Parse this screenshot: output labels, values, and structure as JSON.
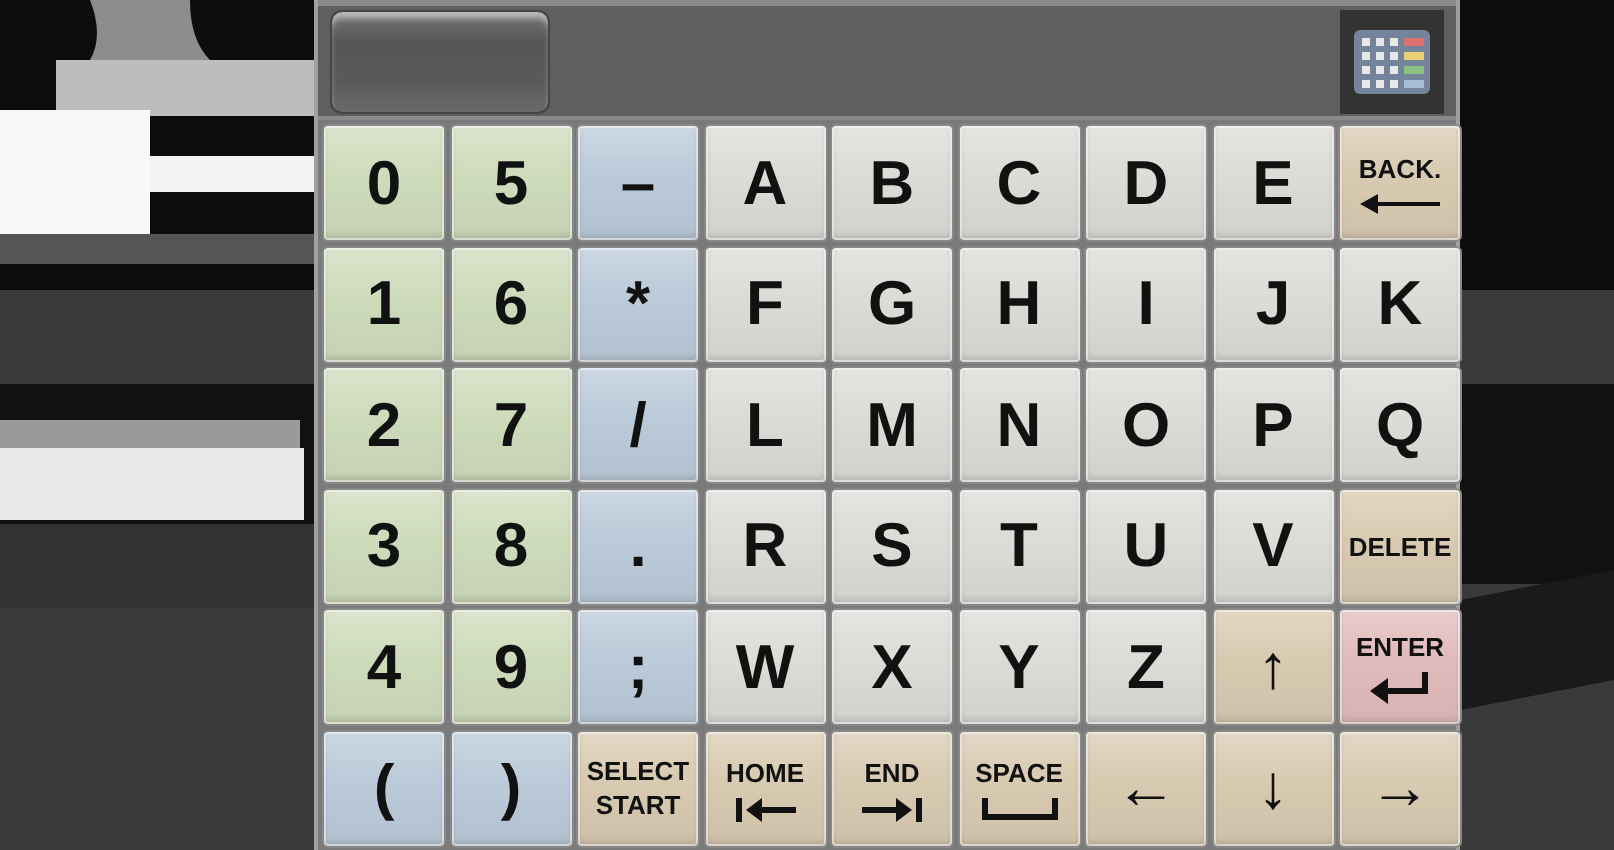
{
  "keyboard": {
    "rows": [
      [
        {
          "label": "0",
          "kind": "char",
          "color": "#cfdcbc"
        },
        {
          "label": "5",
          "kind": "char",
          "color": "#cfdcbc"
        },
        {
          "label": "–",
          "kind": "char",
          "color": "#bccbda"
        },
        {
          "label": "A",
          "kind": "char",
          "color": "#dddcd7"
        },
        {
          "label": "B",
          "kind": "char",
          "color": "#dddcd7"
        },
        {
          "label": "C",
          "kind": "char",
          "color": "#dddcd7"
        },
        {
          "label": "D",
          "kind": "char",
          "color": "#dddcd7"
        },
        {
          "label": "E",
          "kind": "char",
          "color": "#dddcd7"
        },
        {
          "label": "BACK.",
          "kind": "back",
          "color": "#d9cbb2"
        }
      ],
      [
        {
          "label": "1",
          "kind": "char",
          "color": "#cfdcbc"
        },
        {
          "label": "6",
          "kind": "char",
          "color": "#cfdcbc"
        },
        {
          "label": "*",
          "kind": "char",
          "color": "#bccbda"
        },
        {
          "label": "F",
          "kind": "char",
          "color": "#dddcd7"
        },
        {
          "label": "G",
          "kind": "char",
          "color": "#dddcd7"
        },
        {
          "label": "H",
          "kind": "char",
          "color": "#dddcd7"
        },
        {
          "label": "I",
          "kind": "char",
          "color": "#dddcd7"
        },
        {
          "label": "J",
          "kind": "char",
          "color": "#dddcd7"
        },
        {
          "label": "K",
          "kind": "char",
          "color": "#dddcd7"
        }
      ],
      [
        {
          "label": "2",
          "kind": "char",
          "color": "#cfdcbc"
        },
        {
          "label": "7",
          "kind": "char",
          "color": "#cfdcbc"
        },
        {
          "label": "/",
          "kind": "char",
          "color": "#bccbda"
        },
        {
          "label": "L",
          "kind": "char",
          "color": "#dddcd7"
        },
        {
          "label": "M",
          "kind": "char",
          "color": "#dddcd7"
        },
        {
          "label": "N",
          "kind": "char",
          "color": "#dddcd7"
        },
        {
          "label": "O",
          "kind": "char",
          "color": "#dddcd7"
        },
        {
          "label": "P",
          "kind": "char",
          "color": "#dddcd7"
        },
        {
          "label": "Q",
          "kind": "char",
          "color": "#dddcd7"
        }
      ],
      [
        {
          "label": "3",
          "kind": "char",
          "color": "#cfdcbc"
        },
        {
          "label": "8",
          "kind": "char",
          "color": "#cfdcbc"
        },
        {
          "label": ".",
          "kind": "char",
          "color": "#bccbda"
        },
        {
          "label": "R",
          "kind": "char",
          "color": "#dddcd7"
        },
        {
          "label": "S",
          "kind": "char",
          "color": "#dddcd7"
        },
        {
          "label": "T",
          "kind": "char",
          "color": "#dddcd7"
        },
        {
          "label": "U",
          "kind": "char",
          "color": "#dddcd7"
        },
        {
          "label": "V",
          "kind": "char",
          "color": "#dddcd7"
        },
        {
          "label": "DELETE",
          "kind": "text",
          "color": "#d9cbb2"
        }
      ],
      [
        {
          "label": "4",
          "kind": "char",
          "color": "#cfdcbc"
        },
        {
          "label": "9",
          "kind": "char",
          "color": "#cfdcbc"
        },
        {
          "label": ";",
          "kind": "char",
          "color": "#bccbda"
        },
        {
          "label": "W",
          "kind": "char",
          "color": "#dddcd7"
        },
        {
          "label": "X",
          "kind": "char",
          "color": "#dddcd7"
        },
        {
          "label": "Y",
          "kind": "char",
          "color": "#dddcd7"
        },
        {
          "label": "Z",
          "kind": "char",
          "color": "#dddcd7"
        },
        {
          "label": "↑",
          "kind": "char",
          "color": "#d9cbb2"
        },
        {
          "label": "ENTER",
          "kind": "enter",
          "color": "#e2bcbc"
        }
      ],
      [
        {
          "label": "(",
          "kind": "char",
          "color": "#bccbda"
        },
        {
          "label": ")",
          "kind": "char",
          "color": "#bccbda"
        },
        {
          "label": "SELECT START",
          "kind": "text",
          "color": "#d9cbb2"
        },
        {
          "label": "HOME",
          "kind": "home",
          "color": "#d9cbb2"
        },
        {
          "label": "END",
          "kind": "end",
          "color": "#d9cbb2"
        },
        {
          "label": "SPACE",
          "kind": "space",
          "color": "#d9cbb2"
        },
        {
          "label": "←",
          "kind": "char",
          "color": "#d9cbb2"
        },
        {
          "label": "↓",
          "kind": "char",
          "color": "#d9cbb2"
        },
        {
          "label": "→",
          "kind": "char",
          "color": "#d9cbb2"
        }
      ]
    ]
  }
}
